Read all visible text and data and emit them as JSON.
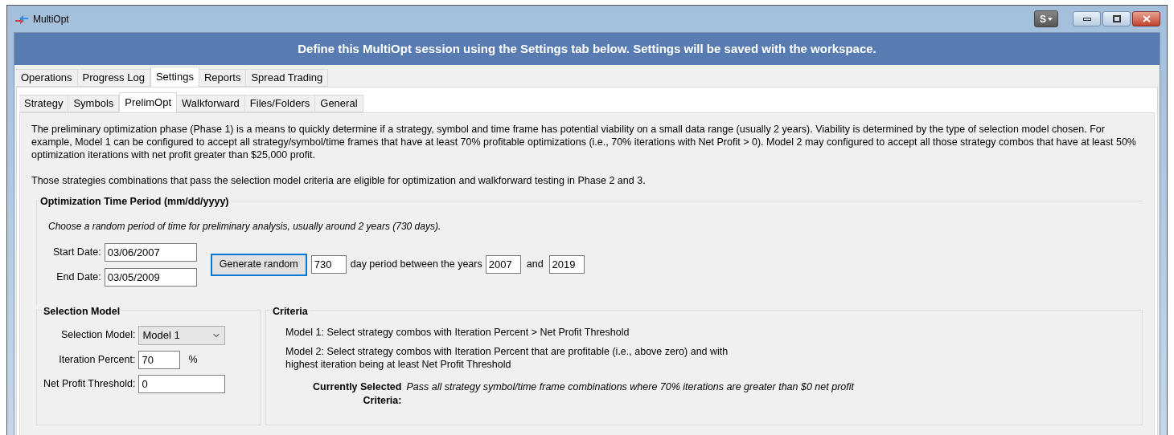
{
  "window": {
    "title": "MultiOpt",
    "user_button": "S"
  },
  "banner": "Define this MultiOpt session using the Settings tab below. Settings will be saved with the workspace.",
  "tabs": [
    {
      "label": "Operations",
      "selected": false
    },
    {
      "label": "Progress Log",
      "selected": false
    },
    {
      "label": "Settings",
      "selected": true
    },
    {
      "label": "Reports",
      "selected": false
    },
    {
      "label": "Spread Trading",
      "selected": false
    }
  ],
  "subtabs": [
    {
      "label": "Strategy",
      "selected": false
    },
    {
      "label": "Symbols",
      "selected": false
    },
    {
      "label": "PrelimOpt",
      "selected": true
    },
    {
      "label": "Walkforward",
      "selected": false
    },
    {
      "label": "Files/Folders",
      "selected": false
    },
    {
      "label": "General",
      "selected": false
    }
  ],
  "description": [
    "The preliminary optimization phase (Phase 1) is a means to quickly determine if a strategy, symbol and time frame has potential viability on a small data range (usually 2 years).  Viability is determined by the type of selection model chosen.  For example, Model 1 can be configured to accept all strategy/symbol/time frames that have at least 70% profitable optimizations (i.e., 70% iterations with Net Profit > 0).  Model 2 may configured to accept all those strategy combos that have at least 50% optimization iterations with net profit greater than $25,000 profit.",
    "Those strategies combinations that pass the selection model criteria are eligible for optimization and walkforward testing in Phase 2 and 3."
  ],
  "time_period": {
    "title": "Optimization Time Period (mm/dd/yyyy)",
    "hint": "Choose a random period of time for preliminary analysis, usually around 2 years (730 days).",
    "start_label": "Start Date:",
    "start_value": "03/06/2007",
    "end_label": "End Date:",
    "end_value": "03/05/2009",
    "generate_button": "Generate random",
    "days_value": "730",
    "between_text": "day period between the years",
    "year_from": "2007",
    "and_text": "and",
    "year_to": "2019"
  },
  "selection_model": {
    "title": "Selection Model",
    "fields": [
      {
        "kind": "dropdown",
        "label": "Selection Model:",
        "value": "Model 1"
      },
      {
        "kind": "text",
        "label": "Iteration Percent:",
        "value": "70",
        "suffix": "%"
      },
      {
        "kind": "text",
        "label": "Net Profit Threshold:",
        "value": "0"
      }
    ]
  },
  "criteria": {
    "title": "Criteria",
    "models": [
      "Model 1: Select strategy combos with Iteration Percent > Net Profit Threshold",
      "Model 2: Select strategy combos with Iteration Percent that are profitable (i.e., above zero) and with\nhighest iteration being at least Net Profit Threshold"
    ],
    "current_label": "Currently Selected\nCriteria:",
    "current_value": "Pass all strategy symbol/time frame combinations where 70% iterations are greater than $0 net profit"
  }
}
